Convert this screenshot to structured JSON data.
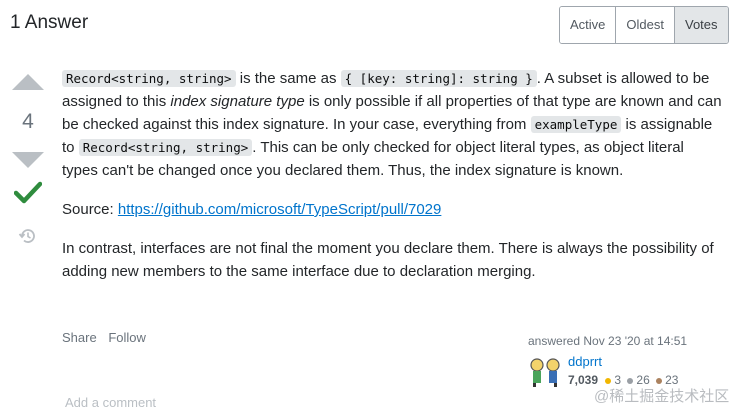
{
  "header": {
    "title": "1 Answer"
  },
  "sort": {
    "options": [
      "Active",
      "Oldest",
      "Votes"
    ],
    "selected": "Votes"
  },
  "vote": {
    "count": "4"
  },
  "body": {
    "p1": {
      "code1": "Record<string, string>",
      "t1": " is the same as ",
      "code2": "{ [key: string]: string }",
      "t2": ". A subset is allowed to be assigned to this ",
      "em": "index signature type",
      "t3": " is only possible if all properties of that type are known and can be checked against this index signature. In your case, everything from ",
      "code3": "exampleType",
      "t4": " is assignable to ",
      "code4": "Record<string, string>",
      "t5": ". This can be only checked for object literal types, as object literal types can't be changed once you declared them. Thus, the index signature is known."
    },
    "p2": {
      "label": "Source: ",
      "link": "https://github.com/microsoft/TypeScript/pull/7029"
    },
    "p3": "In contrast, interfaces are not final the moment you declare them. There is always the possibility of adding new members to the same interface due to declaration merging."
  },
  "menu": {
    "share": "Share",
    "follow": "Follow"
  },
  "user": {
    "action": "answered Nov 23 '20 at 14:51",
    "name": "ddprrt",
    "reputation": "7,039",
    "gold": "3",
    "silver": "26",
    "bronze": "23",
    "badge_colors": {
      "gold": "#f1b600",
      "silver": "#9a9fa5",
      "bronze": "#ab825f"
    }
  },
  "comment": {
    "add": "Add a comment"
  },
  "watermark": "@稀土掘金技术社区",
  "icons": {
    "accepted": "check-icon",
    "history": "history-icon",
    "upvote": "arrow-up-icon",
    "downvote": "arrow-down-icon"
  }
}
